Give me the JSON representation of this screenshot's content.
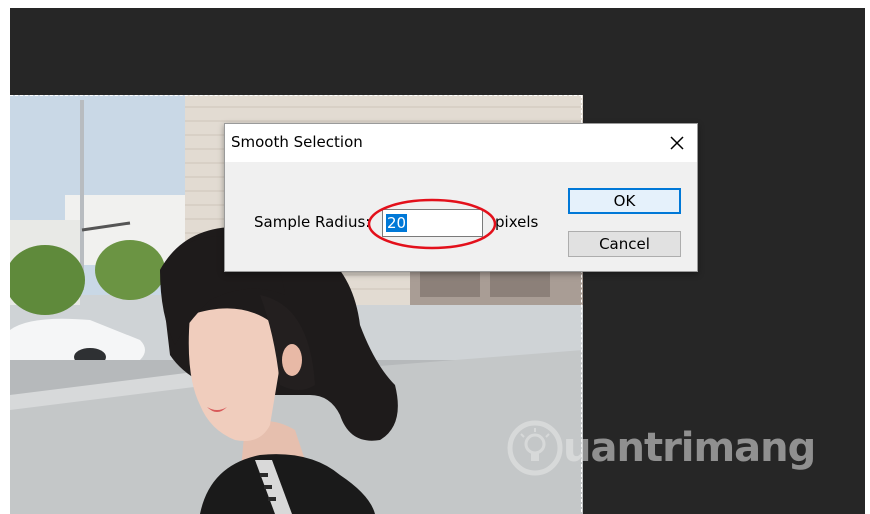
{
  "dialog": {
    "title": "Smooth Selection",
    "field_label": "Sample Radius:",
    "field_value": "20",
    "unit": "pixels",
    "ok_label": "OK",
    "cancel_label": "Cancel"
  },
  "watermark": {
    "text": "uantrimang"
  },
  "icons": {
    "close": "close-icon",
    "watermark_logo": "lightbulb-icon"
  },
  "colors": {
    "workspace": "#262626",
    "selection_highlight": "#0078d7",
    "annotation_circle": "#e3101b"
  }
}
